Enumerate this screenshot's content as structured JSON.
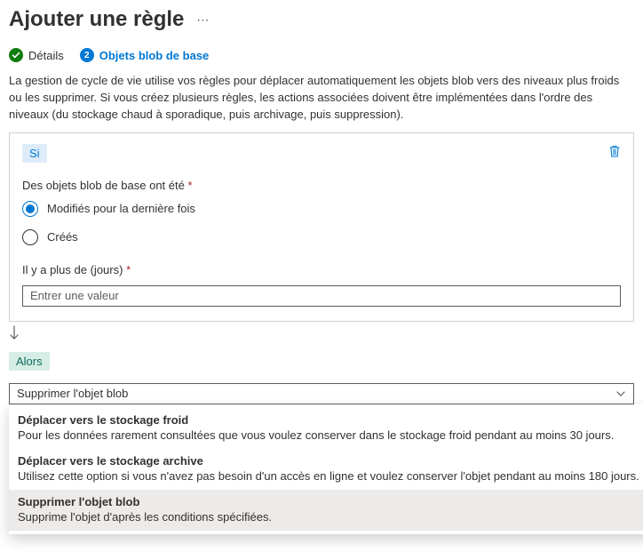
{
  "header": {
    "title": "Ajouter une règle"
  },
  "steps": {
    "done": {
      "label": "Détails"
    },
    "active": {
      "num": "2",
      "label": "Objets blob de base"
    }
  },
  "description": "La gestion de cycle de vie utilise vos règles pour déplacer automatiquement les objets blob vers des niveaux plus froids ou les supprimer. Si vous créez plusieurs règles, les actions associées doivent être implémentées dans l'ordre des niveaux (du stockage chaud à sporadique, puis archivage, puis suppression).",
  "ifBlock": {
    "tag": "Si",
    "label1": "Des objets blob de base ont été",
    "radios": {
      "modified": "Modifiés pour la dernière fois",
      "created": "Créés"
    },
    "label2": "Il y a plus de (jours)",
    "placeholder": "Entrer une valeur"
  },
  "thenBlock": {
    "tag": "Alors",
    "selected": "Supprimer l'objet blob",
    "options": [
      {
        "title": "Déplacer vers le stockage froid",
        "desc": "Pour les données rarement consultées que vous voulez conserver dans le stockage froid pendant au moins 30 jours.",
        "selected": false
      },
      {
        "title": "Déplacer vers le stockage archive",
        "desc": "Utilisez cette option si vous n'avez pas besoin d'un accès en ligne et voulez conserver l'objet pendant au moins 180 jours.",
        "selected": false
      },
      {
        "title": "Supprimer l'objet blob",
        "desc": "Supprime l'objet d'après les conditions spécifiées.",
        "selected": true
      }
    ]
  }
}
